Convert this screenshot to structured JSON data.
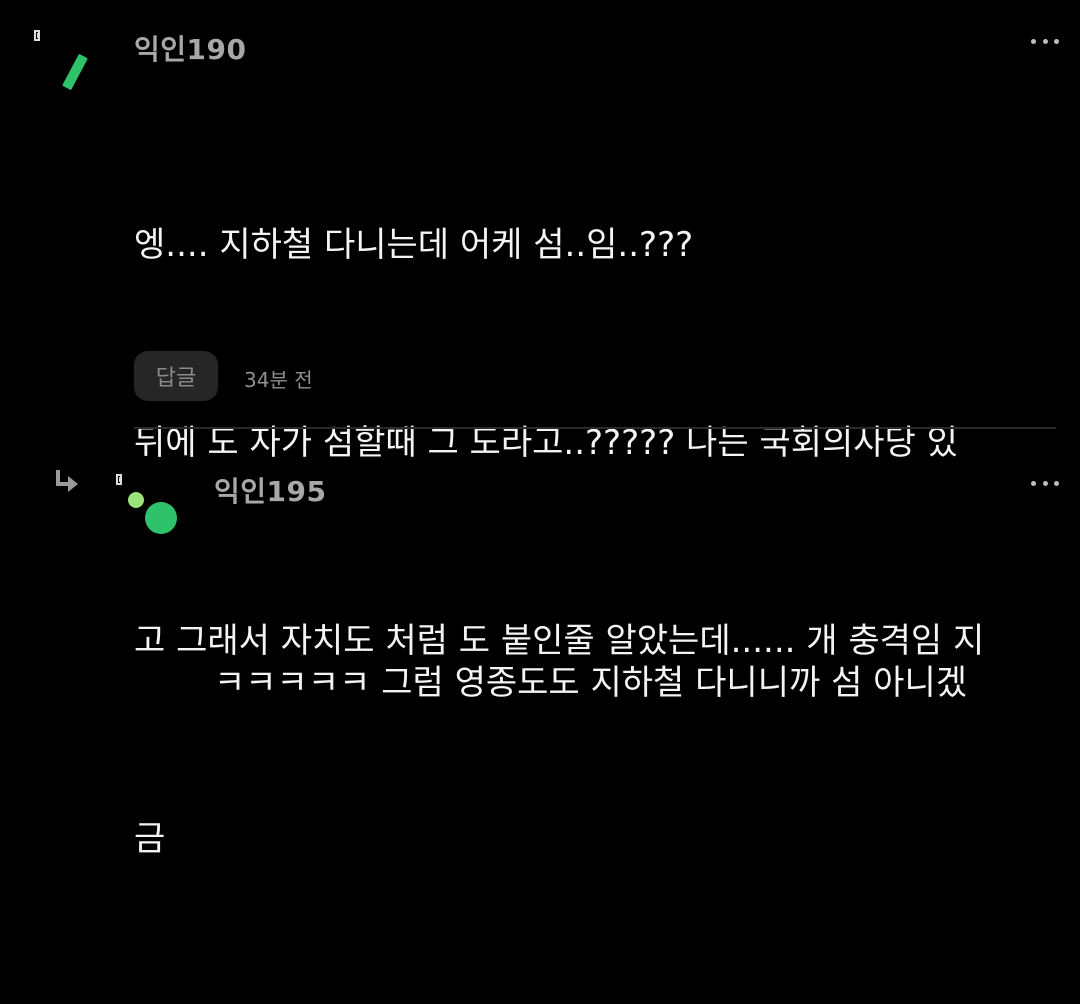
{
  "comments": [
    {
      "username": "익인190",
      "lines": [
        "엥.... 지하철 다니는데 어케 섬..임..???",
        "뒤에 도 자가 섬할때 그 도라고..????? 나는 국회의사당 있",
        "고 그래서 자치도 처럼 도 붙인줄 알았는데...... 개 충격임 지",
        "금"
      ],
      "reply_label": "답글",
      "time": "34분 전",
      "avatar_icon": "green-bar-avatar-icon",
      "flag_icon": "flag-icon",
      "more_icon": "more-options-icon"
    },
    {
      "username": "익인195",
      "lines": [
        "ㅋㅋㅋㅋㅋ 그럼 영종도도 지하철 다니니까 섬 아니겠"
      ],
      "avatar_icon": "green-dots-avatar-icon",
      "flag_icon": "flag-icon",
      "reply_arrow_icon": "reply-arrow-icon",
      "more_icon": "more-options-icon"
    }
  ],
  "colors": {
    "background": "#000000",
    "accent_green": "#2ec26a",
    "light_green": "#9be27a",
    "username": "#a8a8a8",
    "text": "#f4f4f4",
    "muted": "#8f8f8f"
  }
}
